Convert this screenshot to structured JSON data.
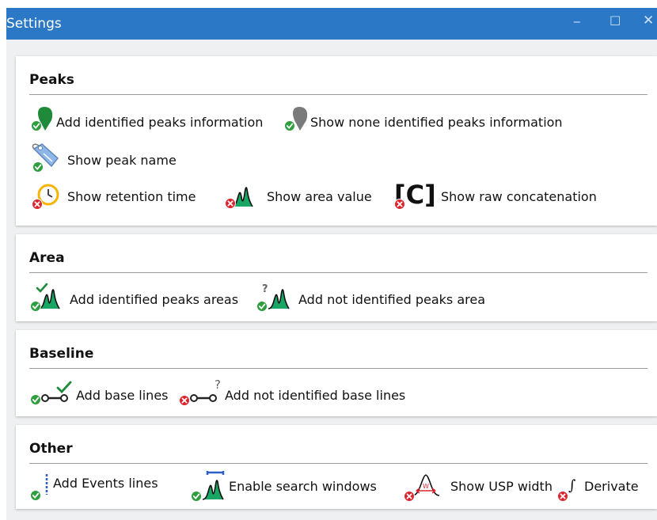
{
  "window": {
    "title": "Settings",
    "minimize": "‒",
    "maximize": "□",
    "close": "✕"
  },
  "colors": {
    "titlebar": "#2b78c7",
    "enabled_badge": "#2e9e3e",
    "disabled_badge": "#d9262e",
    "peak_fill": "#19a564",
    "panel_background": "#eef0f2"
  },
  "sections": {
    "peaks": {
      "title": "Peaks",
      "items": [
        {
          "label": "Add identified peaks information",
          "icon": "green-pin-icon",
          "state": "enabled"
        },
        {
          "label": "Show none identified peaks information",
          "icon": "gray-pin-icon",
          "state": "enabled"
        },
        {
          "label": "Show peak name",
          "icon": "tag-icon",
          "state": "enabled"
        },
        {
          "label": "Show retention time",
          "icon": "clock-icon",
          "state": "disabled"
        },
        {
          "label": "Show area value",
          "icon": "peak-area-icon",
          "state": "disabled"
        },
        {
          "label": "Show raw concatenation",
          "icon": "concatenation-icon",
          "state": "disabled"
        }
      ]
    },
    "area": {
      "title": "Area",
      "items": [
        {
          "label": "Add identified peaks areas",
          "icon": "peak-check-icon",
          "state": "enabled"
        },
        {
          "label": "Add not identified peaks area",
          "icon": "peak-question-icon",
          "state": "enabled"
        }
      ]
    },
    "baseline": {
      "title": "Baseline",
      "items": [
        {
          "label": "Add base lines",
          "icon": "baseline-check-icon",
          "state": "enabled"
        },
        {
          "label": "Add not identified base lines",
          "icon": "baseline-question-icon",
          "state": "disabled"
        }
      ]
    },
    "other": {
      "title": "Other",
      "items": [
        {
          "label": "Add Events lines",
          "icon": "events-line-icon",
          "state": "enabled"
        },
        {
          "label": "Enable search windows",
          "icon": "search-window-icon",
          "state": "enabled"
        },
        {
          "label": "Show USP width",
          "icon": "usp-width-icon",
          "state": "disabled"
        },
        {
          "label": "Derivate",
          "icon": "derivate-icon",
          "state": "disabled"
        }
      ]
    }
  },
  "glyphs": {
    "concatenation": "[C]",
    "usp_w": "W",
    "integral": "∫"
  }
}
